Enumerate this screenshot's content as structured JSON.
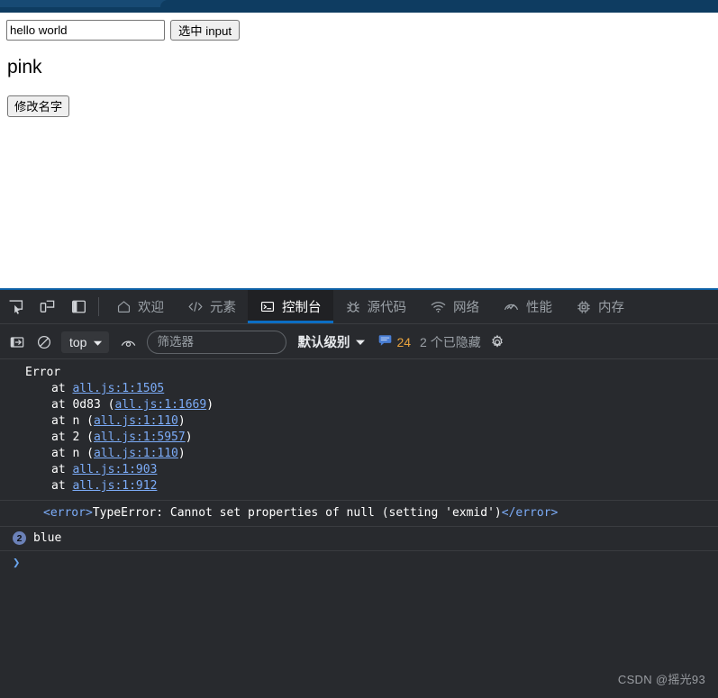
{
  "browser": {
    "chrome_color": "#174a74",
    "active_tab_color": "#0e3c61"
  },
  "page": {
    "text_input_value": "hello world",
    "text_input_placeholder": "",
    "select_input_button_label": "选中 input",
    "name_heading": "pink",
    "rename_button_label": "修改名字"
  },
  "devtools": {
    "accent_color": "#0b6ec4",
    "background": "#282a2e",
    "toolbar_icons": [
      {
        "name": "inspect-element-icon",
        "title": "检查元素"
      },
      {
        "name": "device-toolbar-icon",
        "title": "切换设备工具栏"
      },
      {
        "name": "dock-panel-icon",
        "title": "停靠面板"
      }
    ],
    "tabs": [
      {
        "label": "欢迎",
        "icon": "home-icon",
        "active": false
      },
      {
        "label": "元素",
        "icon": "code-brackets-icon",
        "active": false
      },
      {
        "label": "控制台",
        "icon": "console-terminal-icon",
        "active": true
      },
      {
        "label": "源代码",
        "icon": "bug-icon",
        "active": false
      },
      {
        "label": "网络",
        "icon": "wifi-icon",
        "active": false
      },
      {
        "label": "性能",
        "icon": "gauge-icon",
        "active": false
      },
      {
        "label": "内存",
        "icon": "chip-icon",
        "active": false
      }
    ],
    "console_toolbar": {
      "sidebar_toggle_icon": "sidebar-toggle-icon",
      "clear_console_icon": "clear-console-icon",
      "context_value": "top",
      "live_expression_icon": "eye-icon",
      "filter_placeholder": "筛选器",
      "filter_value": "",
      "level_label": "默认级别",
      "message_count": "24",
      "hidden_label": "2 个已隐藏",
      "settings_icon": "gear-icon"
    },
    "console": {
      "error_stack": {
        "title": "Error",
        "frames": [
          {
            "prefix": "at ",
            "fn": "",
            "link": "all.js:1:1505",
            "paren": false
          },
          {
            "prefix": "at ",
            "fn": "0d83 ",
            "link": "all.js:1:1669",
            "paren": true
          },
          {
            "prefix": "at ",
            "fn": "n ",
            "link": "all.js:1:110",
            "paren": true
          },
          {
            "prefix": "at ",
            "fn": "2 ",
            "link": "all.js:1:5957",
            "paren": true
          },
          {
            "prefix": "at ",
            "fn": "n ",
            "link": "all.js:1:110",
            "paren": true
          },
          {
            "prefix": "at ",
            "fn": "",
            "link": "all.js:1:903",
            "paren": false
          },
          {
            "prefix": "at ",
            "fn": "",
            "link": "all.js:1:912",
            "paren": false
          }
        ]
      },
      "error_message": {
        "open_tag": "<error>",
        "text": "TypeError: Cannot set properties of null (setting 'exmid')",
        "close_tag": "</error>"
      },
      "log_entry": {
        "repeat_count": "2",
        "text": "blue"
      },
      "prompt_symbol": "❯"
    }
  },
  "watermark": "CSDN @摇光93"
}
